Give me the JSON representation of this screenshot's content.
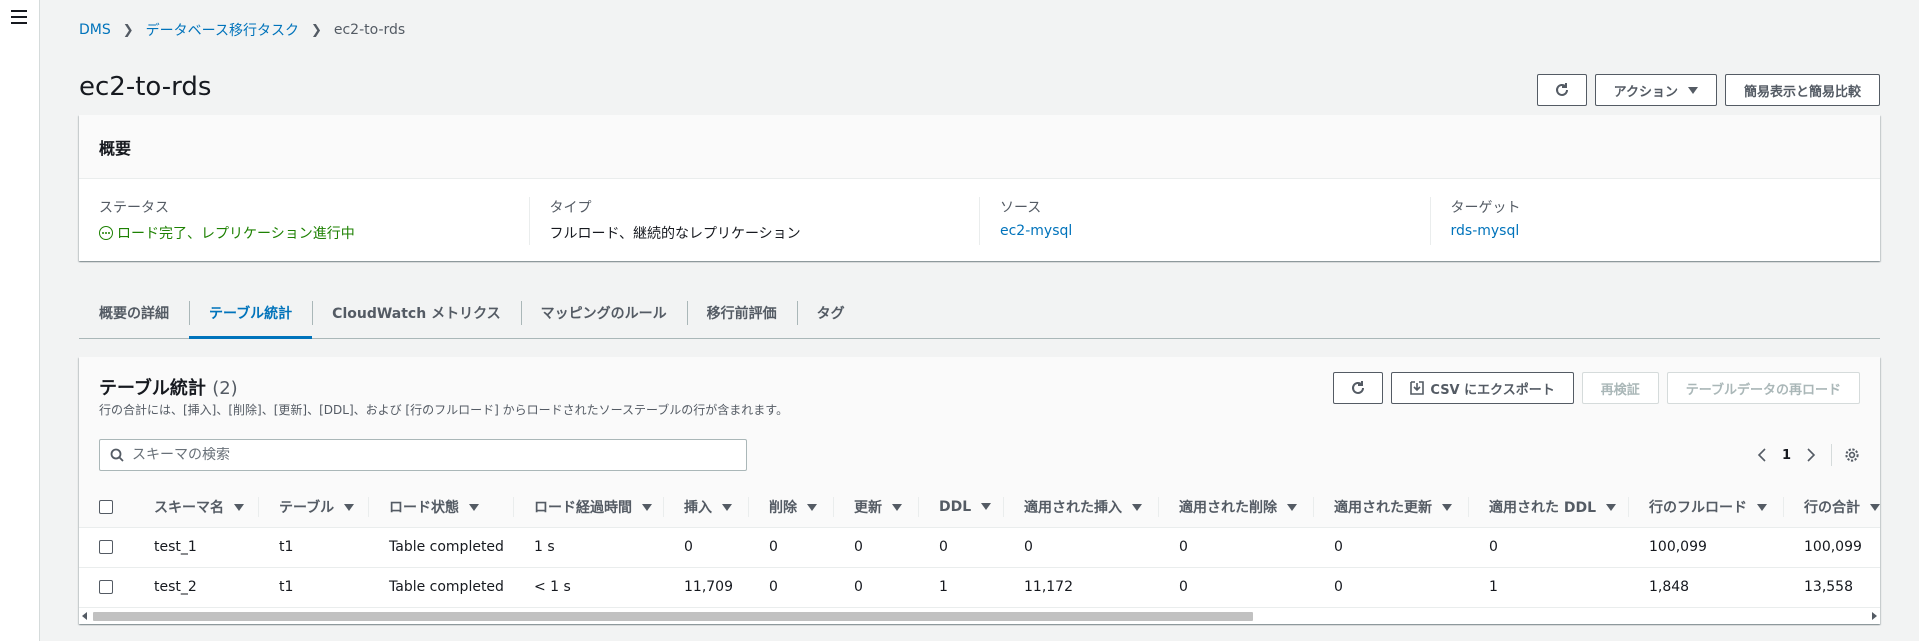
{
  "breadcrumb": [
    "DMS",
    "データベース移行タスク",
    "ec2-to-rds"
  ],
  "title": "ec2-to-rds",
  "header_buttons": {
    "refresh_icon": "refresh-icon",
    "actions": "アクション",
    "compare": "簡易表示と簡易比較"
  },
  "summary": {
    "heading": "概要",
    "status_label": "ステータス",
    "status_value": "ロード完了、レプリケーション進行中",
    "type_label": "タイプ",
    "type_value": "フルロード、継続的なレプリケーション",
    "source_label": "ソース",
    "source_value": "ec2-mysql",
    "target_label": "ターゲット",
    "target_value": "rds-mysql"
  },
  "tabs": [
    "概要の詳細",
    "テーブル統計",
    "CloudWatch メトリクス",
    "マッピングのルール",
    "移行前評価",
    "タグ"
  ],
  "active_tab": "テーブル統計",
  "table_stats": {
    "title": "テーブル統計",
    "count": "(2)",
    "description": "行の合計には、[挿入]、[削除]、[更新]、[DDL]、および [行のフルロード] からロードされたソーステーブルの行が含まれます。",
    "export_label": "CSV にエクスポート",
    "revalidate_label": "再検証",
    "reload_label": "テーブルデータの再ロード",
    "search_placeholder": "スキーマの検索",
    "page": "1",
    "columns": [
      "スキーマ名",
      "テーブル",
      "ロード状態",
      "ロード経過時間",
      "挿入",
      "削除",
      "更新",
      "DDL",
      "適用された挿入",
      "適用された削除",
      "適用された更新",
      "適用された DDL",
      "行のフルロード",
      "行の合計"
    ],
    "rows": [
      [
        "test_1",
        "t1",
        "Table completed",
        "1 s",
        "0",
        "0",
        "0",
        "0",
        "0",
        "0",
        "0",
        "0",
        "100,099",
        "100,099"
      ],
      [
        "test_2",
        "t1",
        "Table completed",
        "< 1 s",
        "11,709",
        "0",
        "0",
        "1",
        "11,172",
        "0",
        "0",
        "1",
        "1,848",
        "13,558"
      ]
    ]
  },
  "colors": {
    "link": "#0073bb",
    "success": "#1d8102",
    "text": "#16191f",
    "muted": "#545b64"
  }
}
